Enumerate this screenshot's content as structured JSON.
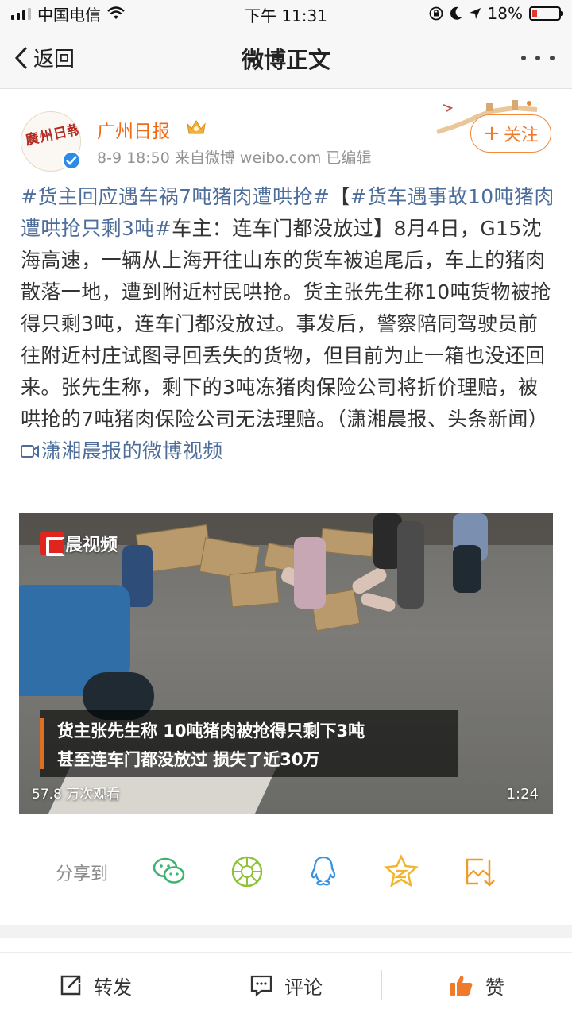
{
  "status_bar": {
    "carrier": "中国电信",
    "time": "下午 11:31",
    "battery": "18%",
    "battery_color": "#e03a30"
  },
  "nav": {
    "back_label": "返回",
    "title": "微博正文",
    "more_icon": "more-icon"
  },
  "author": {
    "name": "广州日报",
    "avatar_text": "廣州日報",
    "meta": "8-9 18:50  来自微博 weibo.com  已编辑",
    "follow_label": "关注",
    "name_color": "#f06a16"
  },
  "post": {
    "tag1": "#货主回应遇车祸7吨猪肉遭哄抢#",
    "bracket_open": "【",
    "tag2": "#货车遇事故10吨猪肉遭哄抢只剩3吨#",
    "body": "车主：连车门都没放过】8月4日，G15沈海高速，一辆从上海开往山东的货车被追尾后，车上的猪肉散落一地，遭到附近村民哄抢。货主张先生称10吨货物被抢得只剩3吨，连车门都没放过。事发后，警察陪同驾驶员前往附近村庄试图寻回丢失的货物，但目前为止一箱也没还回来。张先生称，剩下的3吨冻猪肉保险公司将折价理赔，被哄抢的7吨猪肉保险公司无法理赔。（潇湘晨报、头条新闻）",
    "video_link": "潇湘晨报的微博视频",
    "link_color": "#4d6d9a"
  },
  "video": {
    "logo_text": "晨视频",
    "caption_line1": "货主张先生称  10吨猪肉被抢得只剩下3吨",
    "caption_line2": "甚至连车门都没放过  损失了近30万",
    "views": "57.8 万次观看",
    "duration": "1:24"
  },
  "share": {
    "label": "分享到",
    "icons": [
      "wechat-icon",
      "moments-icon",
      "qq-icon",
      "qzone-icon",
      "save-image-icon"
    ]
  },
  "toolbar": {
    "repost": "转发",
    "comment": "评论",
    "like": "赞",
    "like_color": "#f07a2c"
  }
}
